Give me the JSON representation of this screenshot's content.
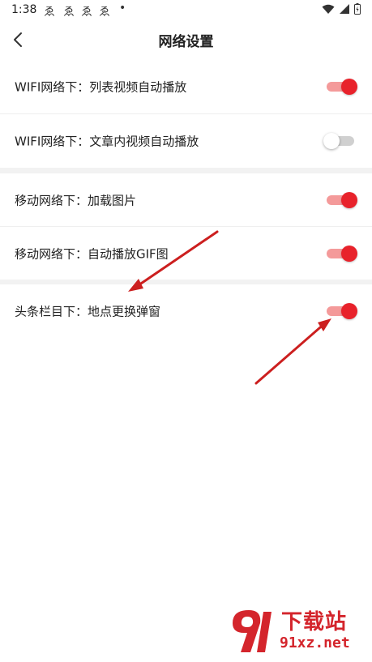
{
  "status_bar": {
    "time": "1:38",
    "notification_glyph": "ゑ",
    "dot": "•",
    "icons": [
      "wifi-icon",
      "cellular-icon",
      "battery-icon"
    ]
  },
  "header": {
    "title": "网络设置",
    "back_icon": "chevron-left-icon"
  },
  "settings": [
    {
      "label": "WIFI网络下：列表视频自动播放",
      "enabled": true
    },
    {
      "label": "WIFI网络下：文章内视频自动播放",
      "enabled": false
    },
    {
      "label": "移动网络下：加载图片",
      "enabled": true
    },
    {
      "label": "移动网络下：自动播放GIF图",
      "enabled": true
    },
    {
      "label": "头条栏目下：地点更换弹窗",
      "enabled": true
    }
  ],
  "colors": {
    "accent": "#e8222b",
    "track_on": "#f49a9a",
    "track_off": "#d0d0d0",
    "annotation_arrow": "#cc1f1f"
  },
  "watermark": {
    "title": "下载站",
    "url": "91xz.net",
    "logo_text": "91"
  }
}
